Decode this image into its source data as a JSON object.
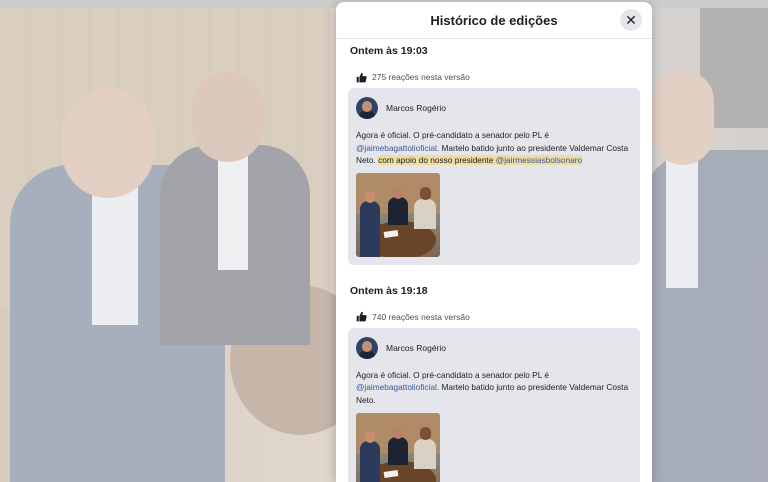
{
  "modal": {
    "title": "Histórico de edições",
    "close_icon": "close-icon"
  },
  "versions": [
    {
      "time": "Ontem às 19:03",
      "reactions": "275 reações nesta versão",
      "author": "Marcos Rogério",
      "text_before": "Agora é oficial. O pré-candidato a senador pelo PL é ",
      "mention_1": "@jaimebagattolioficial",
      "text_middle": ". Martelo batido junto ao presidente Valdemar Costa Neto. ",
      "highlight_text": "com apoio do nosso presidente ",
      "mention_2": "@jairmessiasbolsonaro"
    },
    {
      "time": "Ontem às 19:18",
      "reactions": "740 reações nesta versão",
      "author": "Marcos Rogério",
      "text_before": "Agora é oficial. O pré-candidato a senador pelo PL é ",
      "mention_1": "@jaimebagattolioficial",
      "text_middle": ". Martelo batido junto ao presidente Valdemar Costa Neto."
    }
  ],
  "colors": {
    "mention": "#385898",
    "highlight": "#efdca0",
    "card_bg": "#e4e6eb"
  }
}
